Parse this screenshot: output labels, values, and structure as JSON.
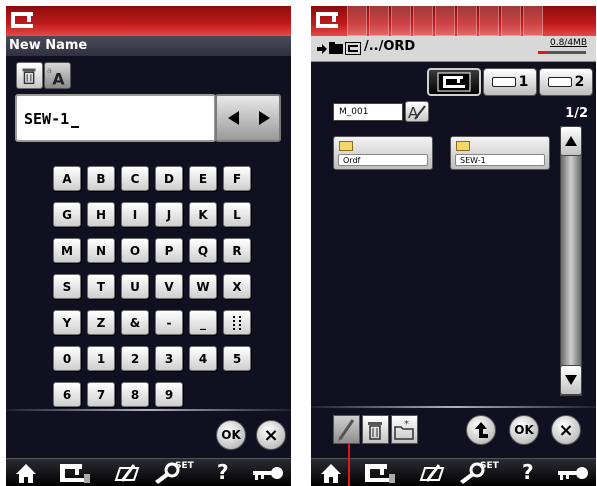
{
  "colors": {
    "accent_red": "#c21b1b",
    "panel_bg": "#101020",
    "memory_used": "#e01818"
  },
  "left": {
    "title": "New Name",
    "name_value": "SEW-1",
    "keys": [
      "A",
      "B",
      "C",
      "D",
      "E",
      "F",
      "G",
      "H",
      "I",
      "J",
      "K",
      "L",
      "M",
      "N",
      "O",
      "P",
      "Q",
      "R",
      "S",
      "T",
      "U",
      "V",
      "W",
      "X",
      "Y",
      "Z",
      "&",
      "-",
      "_",
      "",
      "0",
      "1",
      "2",
      "3",
      "4",
      "5",
      "6",
      "7",
      "8",
      "9"
    ],
    "ok_label": "OK",
    "close_label": "×"
  },
  "right": {
    "path": "/../ORD",
    "memory": "0.8/4MB",
    "memory_fraction": 0.2,
    "device1_label": "1",
    "device2_label": "2",
    "filter_value": "M_001",
    "page": "1/2",
    "folders": [
      "Ordf",
      "SEW-1"
    ],
    "ok_label": "OK",
    "close_label": "×"
  },
  "bottom_bar": {
    "set_label": "SET",
    "help_label": "?"
  },
  "icons": [
    "machine-icon",
    "home-icon",
    "sewing-mode-icon",
    "edit-icon",
    "settings-icon",
    "help-icon",
    "key-icon",
    "delete-icon",
    "font-icon",
    "left-arrow-icon",
    "right-arrow-icon",
    "folder-icon",
    "usb-icon",
    "up-folder-icon",
    "pencil-icon",
    "new-folder-icon",
    "scroll-up-icon",
    "scroll-down-icon"
  ]
}
